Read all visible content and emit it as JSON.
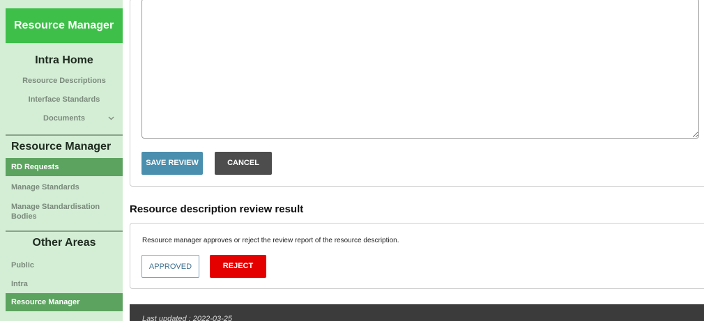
{
  "sidebar": {
    "header": "Resource Manager",
    "intra": {
      "title": "Intra Home",
      "links": [
        "Resource Descriptions",
        "Interface Standards",
        "Documents"
      ]
    },
    "resource_manager": {
      "title": "Resource Manager",
      "links": [
        "RD Requests",
        "Manage Standards",
        "Manage Standardisation Bodies"
      ],
      "active": "RD Requests"
    },
    "other_areas": {
      "title": "Other Areas",
      "links": [
        "Public",
        "Intra",
        "Resource Manager"
      ],
      "active": "Resource Manager"
    },
    "colors": {
      "header": "#3ebf49",
      "background": "#d4edd5",
      "active": "#5ba35f"
    }
  },
  "review": {
    "textarea_value": "",
    "save_label": "SAVE REVIEW",
    "cancel_label": "CANCEL"
  },
  "result": {
    "title": "Resource description review result",
    "description": "Resource manager approves or reject the review report of the resource description.",
    "approved_label": "APPROVED",
    "reject_label": "REJECT"
  },
  "footer": {
    "text": "Last updated : 2022-03-25"
  }
}
